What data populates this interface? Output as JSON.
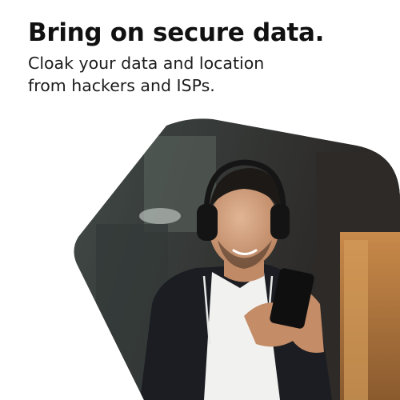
{
  "hero": {
    "title": "Bring on secure data.",
    "subtitle": "Cloak your data and location from hackers and ISPs."
  },
  "image": {
    "subject": "photo-man-headphones-phone"
  },
  "colors": {
    "background": "#ffffff",
    "text": "#111111"
  }
}
